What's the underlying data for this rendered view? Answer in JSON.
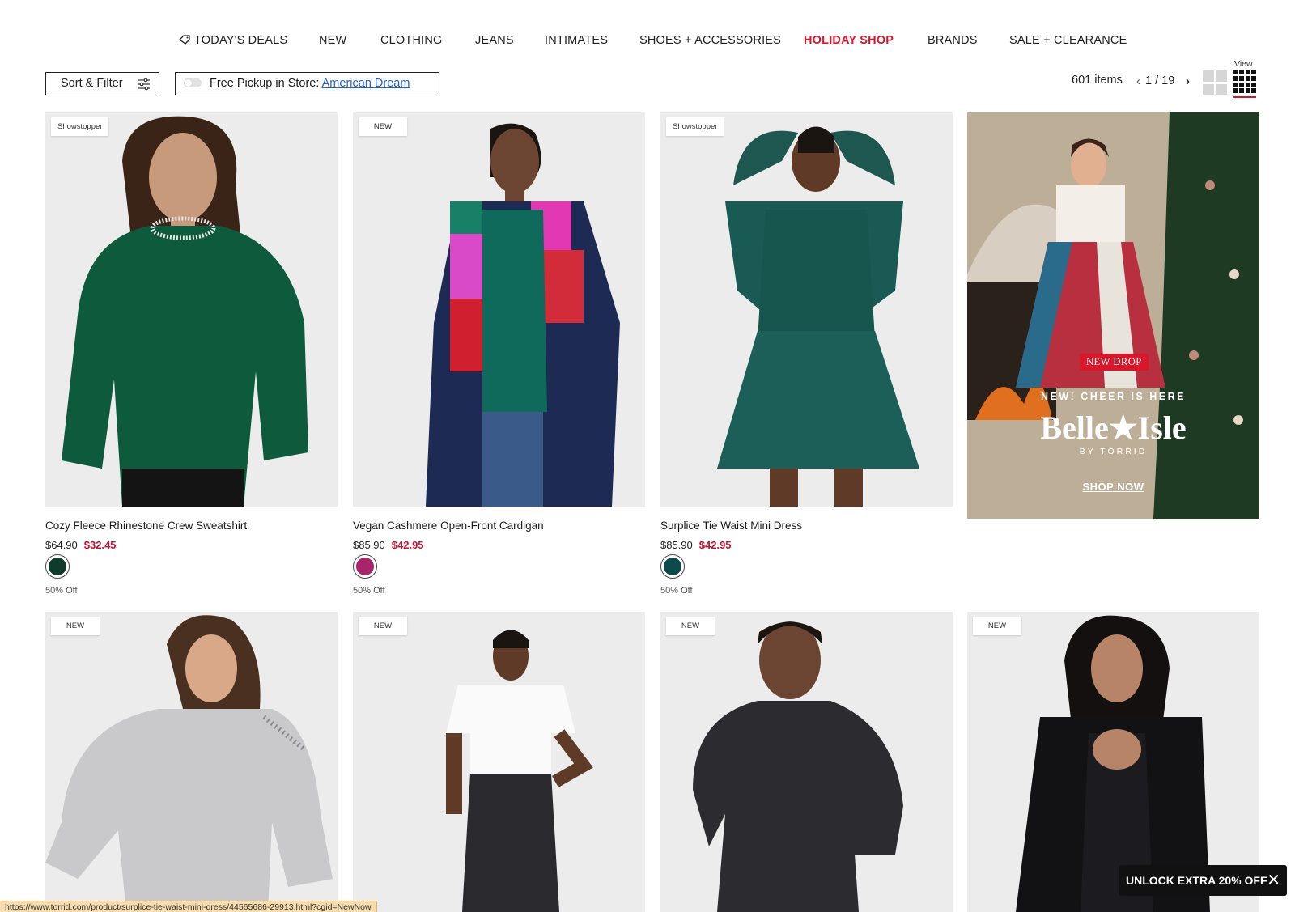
{
  "nav": {
    "items": [
      "TODAY'S DEALS",
      "NEW",
      "CLOTHING",
      "JEANS",
      "INTIMATES",
      "SHOES + ACCESSORIES",
      "HOLIDAY SHOP",
      "BRANDS",
      "SALE + CLEARANCE"
    ],
    "active_color": "#d8172b"
  },
  "toolbar": {
    "sort_label": "Sort & Filter",
    "pickup_label": "Free Pickup in Store:",
    "store_name": "American Dream",
    "items_count": "601 items",
    "page": "1 / 19",
    "prev": "‹",
    "next": "›",
    "view_label": "View"
  },
  "products": [
    {
      "badge": "Showstopper",
      "name": "Cozy Fleece Rhinestone Crew Sweatshirt",
      "was": "$64.90",
      "now": "$32.45",
      "swatch": "#0e3b2b",
      "off": "50% Off",
      "image": "woman in green rhinestone sweatshirt"
    },
    {
      "badge": "NEW",
      "name": "Vegan Cashmere Open-Front Cardigan",
      "was": "$85.90",
      "now": "$42.95",
      "swatch": "#a8246b",
      "off": "50% Off",
      "image": "woman in colorblock cardigan"
    },
    {
      "badge": "Showstopper",
      "name": "Surplice Tie Waist Mini Dress",
      "was": "$85.90",
      "now": "$42.95",
      "swatch": "#0f4a4a",
      "off": "50% Off",
      "image": "woman in teal metallic mini dress"
    },
    {
      "badge": "NEW",
      "image": "woman in grey embellished sweatshirt"
    },
    {
      "badge": "NEW",
      "image": "woman in white tee and black jeans"
    },
    {
      "badge": "NEW",
      "image": "woman in black sequin top"
    },
    {
      "badge": "NEW",
      "image": "woman in black lace cardigan"
    }
  ],
  "promo": {
    "tag": "NEW DROP",
    "subtitle": "NEW! CHEER IS HERE",
    "brand": "Belle★Isle",
    "by": "BY TORRID",
    "cta": "SHOP NOW"
  },
  "unlock": {
    "label": "UNLOCK EXTRA 20% OFF",
    "close": "✕"
  },
  "status_url": "https://www.torrid.com/product/surplice-tie-waist-mini-dress/44565686-29913.html?cgid=NewNow",
  "colors": {
    "accent": "#d8172b",
    "sale_price": "#c8102e",
    "link": "#1f5fd6"
  }
}
